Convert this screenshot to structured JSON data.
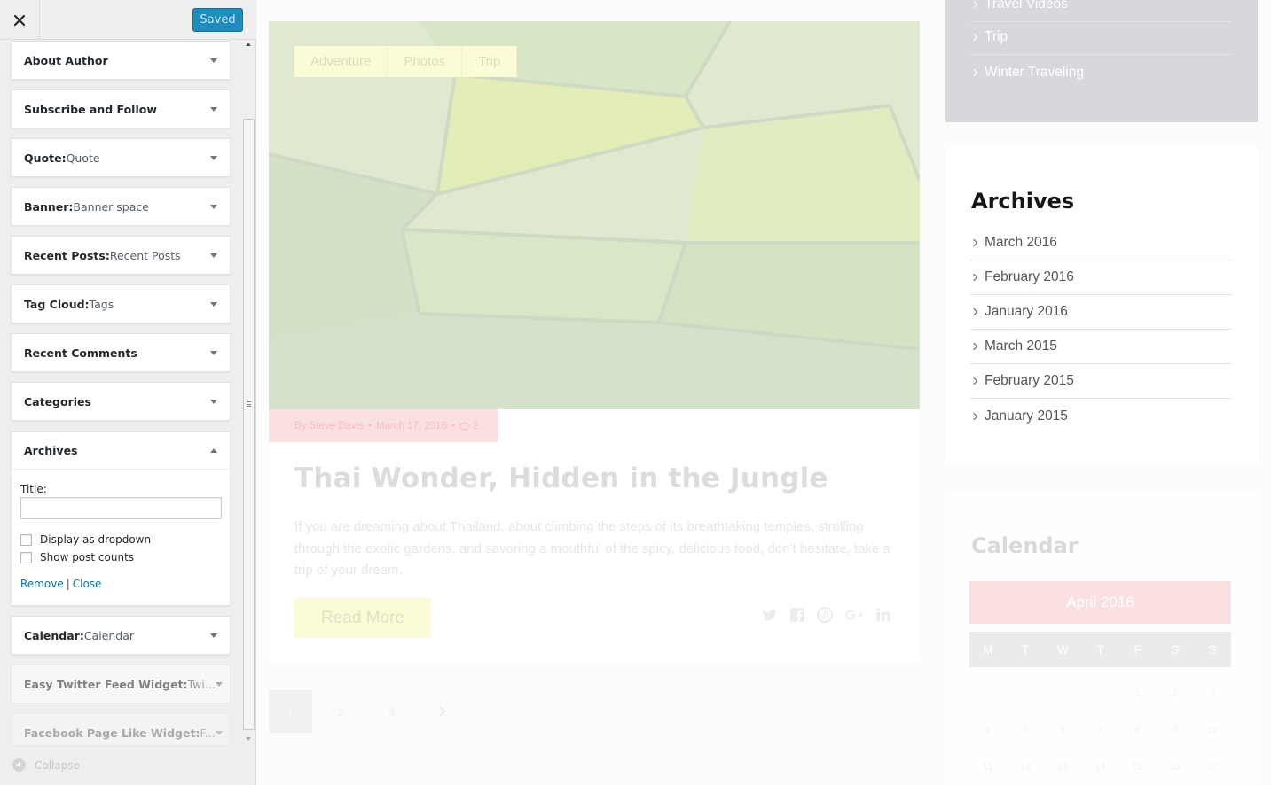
{
  "panel": {
    "close_label": "×",
    "save_status": "Saved",
    "widgets": [
      {
        "title": "About Author",
        "subtitle": ""
      },
      {
        "title": "Subscribe and Follow",
        "subtitle": ""
      },
      {
        "title": "Quote:",
        "subtitle": " Quote"
      },
      {
        "title": "Banner:",
        "subtitle": " Banner space"
      },
      {
        "title": "Recent Posts:",
        "subtitle": " Recent Posts"
      },
      {
        "title": "Tag Cloud:",
        "subtitle": " Tags"
      },
      {
        "title": "Recent Comments",
        "subtitle": ""
      },
      {
        "title": "Categories",
        "subtitle": ""
      },
      {
        "title": "Archives",
        "subtitle": ""
      },
      {
        "title": "Calendar:",
        "subtitle": " Calendar"
      },
      {
        "title": "Easy Twitter Feed Widget:",
        "subtitle": " Twi..."
      },
      {
        "title": "Facebook Page Like Widget:",
        "subtitle": " F..."
      }
    ],
    "archives_form": {
      "title_label": "Title:",
      "title_value": "",
      "display_dropdown_label": "Display as dropdown",
      "display_dropdown_checked": false,
      "show_counts_label": "Show post counts",
      "show_counts_checked": false,
      "remove_label": "Remove",
      "separator": "|",
      "close_label": "Close"
    },
    "collapse_label": "Collapse"
  },
  "preview": {
    "post": {
      "tags": [
        "Adventure",
        "Photos",
        "Trip"
      ],
      "author": "By Steve Davis",
      "date": "March 17, 2016",
      "comments": "2",
      "title": "Thai Wonder, Hidden in the Jungle",
      "excerpt": "If you are dreaming about Thailand, about climbing the steps of its breathtaking temples, strolling through the exotic gardens, and savoring a mouthful of the spicy, delicious food, don’t hesitate, take a trip of your dream.",
      "read_more": "Read More",
      "share_icons": [
        "twitter-icon",
        "facebook-icon",
        "pinterest-icon",
        "google-plus-icon",
        "linkedin-icon"
      ]
    },
    "pagination": {
      "pages": [
        "1",
        "2",
        "3"
      ],
      "current": "1",
      "next_icon": "chevron-right-icon"
    },
    "categories": {
      "items": [
        "Travel Videos",
        "Trip",
        "Winter Traveling"
      ]
    },
    "archives": {
      "title": "Archives",
      "items": [
        "March 2016",
        "February 2016",
        "January 2016",
        "March 2015",
        "February 2015",
        "January 2015"
      ]
    },
    "calendar": {
      "title": "Calendar",
      "month": "April 2016",
      "days": [
        "M",
        "T",
        "W",
        "T",
        "F",
        "S",
        "S"
      ],
      "weeks": [
        [
          "",
          "",
          "",
          "",
          "1",
          "2",
          "3"
        ],
        [
          "4",
          "5",
          "6",
          "7",
          "8",
          "9",
          "10"
        ],
        [
          "11",
          "12",
          "13",
          "14",
          "15",
          "16",
          "17"
        ]
      ]
    }
  },
  "colors": {
    "accent_blue": "#1e8cbe",
    "tag_yellow": "#fbfcd6",
    "meta_pink": "#fbe0e2",
    "category_bg": "#d7d7dc"
  }
}
